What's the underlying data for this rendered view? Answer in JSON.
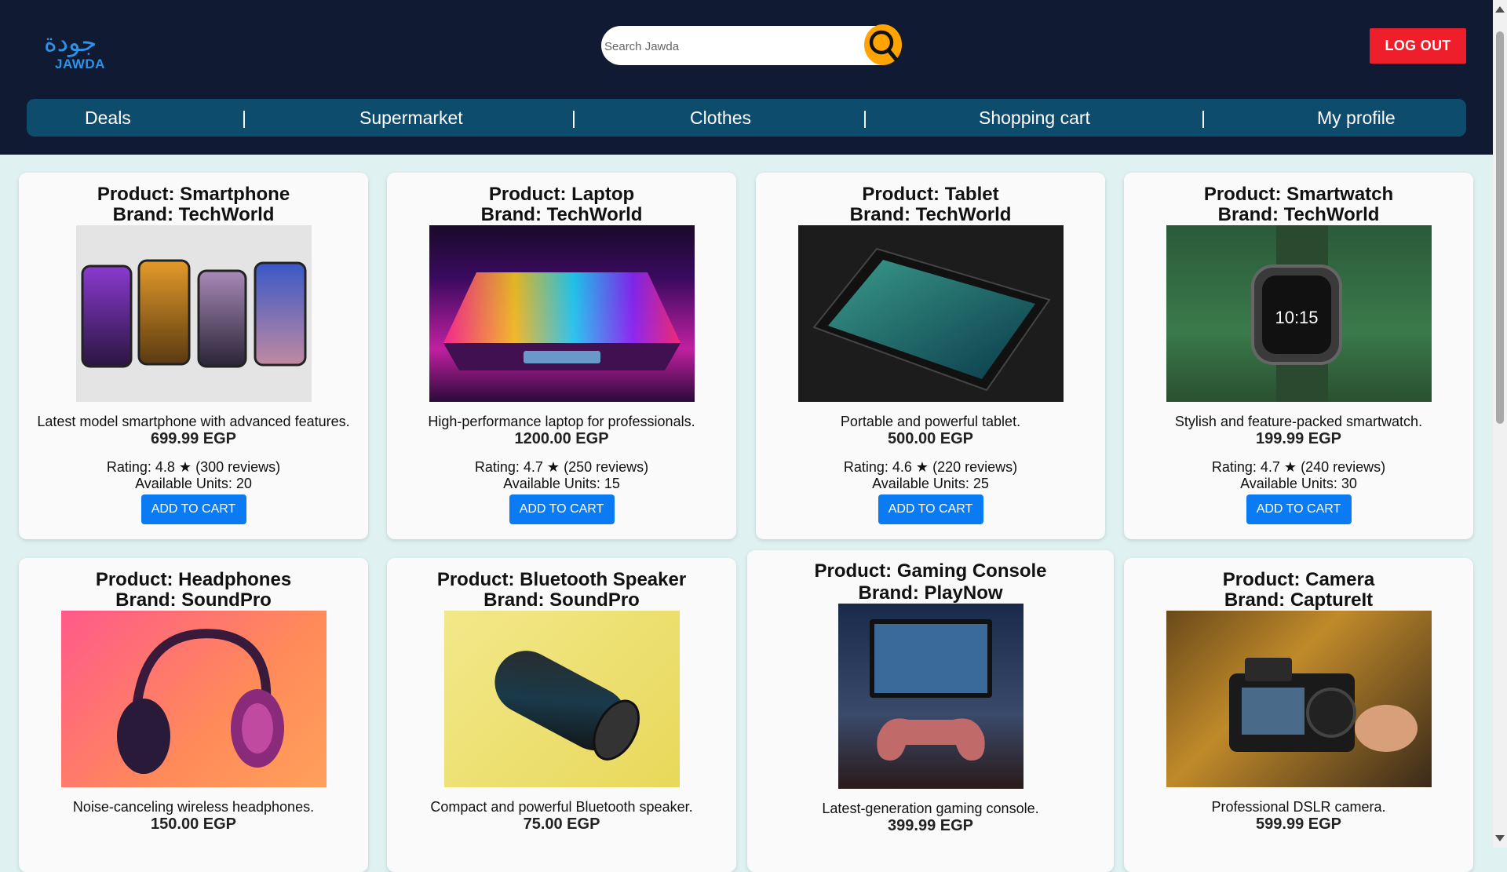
{
  "header": {
    "logo_arabic": "جودة",
    "logo_text": "JAWDA",
    "search_placeholder": "Search Jawda",
    "logout_label": "LOG OUT",
    "colors": {
      "header_bg": "#111a33",
      "nav_bg": "#0e4c6e",
      "logout_bg": "#ee1f2a",
      "search_btn": "#ffa400",
      "accent": "#0a7bf2"
    }
  },
  "nav": {
    "items": [
      "Deals",
      "Supermarket",
      "Clothes",
      "Shopping cart",
      "My profile"
    ],
    "separator": "|"
  },
  "products": [
    {
      "title": "Product: Smartphone",
      "brand": "Brand: TechWorld",
      "desc": "Latest model smartphone with advanced features.",
      "price": "699.99 EGP",
      "rating": "Rating: 4.8 ★ (300 reviews)",
      "units": "Available Units: 20",
      "button": "ADD TO CART"
    },
    {
      "title": "Product: Laptop",
      "brand": "Brand: TechWorld",
      "desc": "High-performance laptop for professionals.",
      "price": "1200.00 EGP",
      "rating": "Rating: 4.7 ★ (250 reviews)",
      "units": "Available Units: 15",
      "button": "ADD TO CART"
    },
    {
      "title": "Product: Tablet",
      "brand": "Brand: TechWorld",
      "desc": "Portable and powerful tablet.",
      "price": "500.00 EGP",
      "rating": "Rating: 4.6 ★ (220 reviews)",
      "units": "Available Units: 25",
      "button": "ADD TO CART"
    },
    {
      "title": "Product: Smartwatch",
      "brand": "Brand: TechWorld",
      "desc": "Stylish and feature-packed smartwatch.",
      "price": "199.99 EGP",
      "rating": "Rating: 4.7 ★ (240 reviews)",
      "units": "Available Units: 30",
      "button": "ADD TO CART",
      "watch_time": "10:15"
    },
    {
      "title": "Product: Headphones",
      "brand": "Brand: SoundPro",
      "desc": "Noise-canceling wireless headphones.",
      "price": "150.00 EGP"
    },
    {
      "title": "Product: Bluetooth Speaker",
      "brand": "Brand: SoundPro",
      "desc": "Compact and powerful Bluetooth speaker.",
      "price": "75.00 EGP"
    },
    {
      "title": "Product: Gaming Console",
      "brand": "Brand: PlayNow",
      "desc": "Latest-generation gaming console.",
      "price": "399.99 EGP"
    },
    {
      "title": "Product: Camera",
      "brand": "Brand: CaptureIt",
      "desc": "Professional DSLR camera.",
      "price": "599.99 EGP"
    }
  ]
}
